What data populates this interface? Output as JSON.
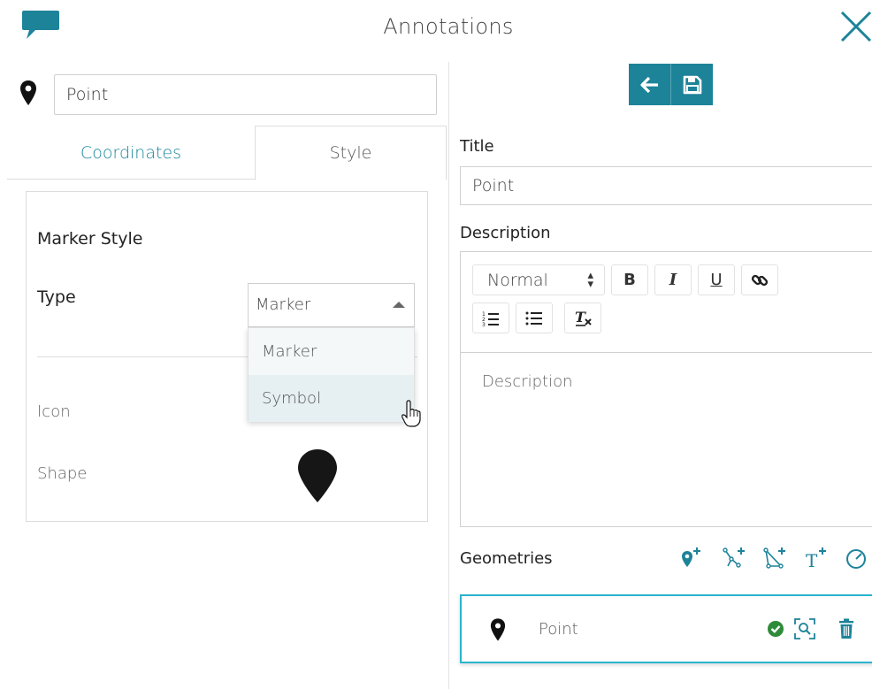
{
  "header": {
    "title": "Annotations"
  },
  "left": {
    "name_value": "Point",
    "tabs": [
      {
        "label": "Coordinates"
      },
      {
        "label": "Style"
      }
    ],
    "style": {
      "section_title": "Marker Style",
      "type_label": "Type",
      "type_selected": "Marker",
      "type_options": [
        "Marker",
        "Symbol"
      ],
      "icon_label": "Icon",
      "shape_label": "Shape"
    }
  },
  "right": {
    "title_label": "Title",
    "title_value": "Point",
    "description_label": "Description",
    "format_select": "Normal",
    "toolbar": {
      "bold": "B",
      "italic": "I",
      "underline": "U"
    },
    "description_placeholder": "Description",
    "geometries_label": "Geometries",
    "geometries": [
      {
        "name": "Point"
      }
    ]
  },
  "colors": {
    "accent": "#1d8399",
    "tab_active_text": "#17869b",
    "geometry_border": "#29b4cf",
    "check_green": "#2e8b3a"
  },
  "icons": [
    "chat-bubble-icon",
    "close-icon",
    "map-pin-icon",
    "back-arrow-icon",
    "save-icon",
    "list-ordered-icon",
    "list-bullet-icon",
    "clear-format-icon",
    "link-icon",
    "add-point-icon",
    "add-line-icon",
    "add-polygon-icon",
    "add-text-icon",
    "add-circle-icon",
    "check-icon",
    "zoom-to-icon",
    "trash-icon",
    "hand-cursor-icon"
  ]
}
